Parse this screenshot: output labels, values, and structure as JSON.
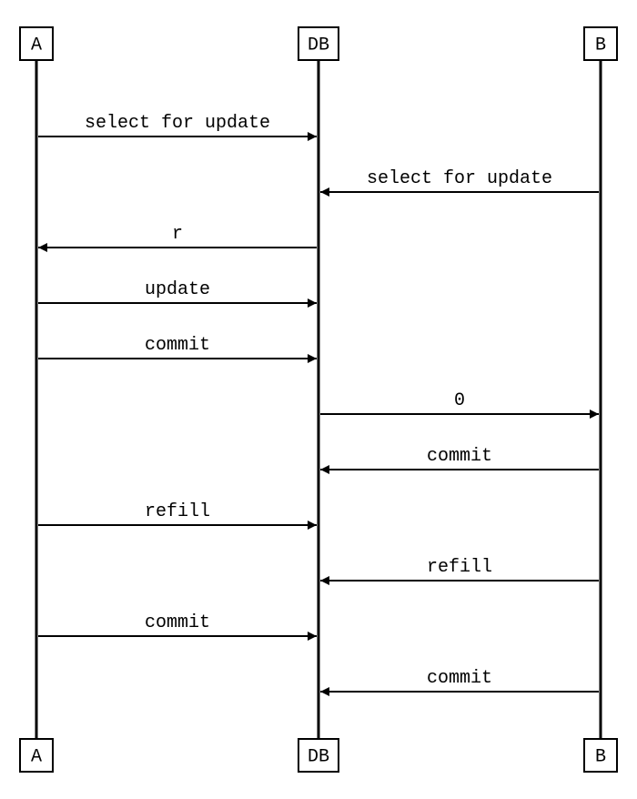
{
  "chart_data": {
    "type": "sequence",
    "actors": [
      {
        "id": "A",
        "label": "A"
      },
      {
        "id": "DB",
        "label": "DB"
      },
      {
        "id": "B",
        "label": "B"
      }
    ],
    "messages": [
      {
        "from": "A",
        "to": "DB",
        "label": "select for update"
      },
      {
        "from": "B",
        "to": "DB",
        "label": "select for update"
      },
      {
        "from": "DB",
        "to": "A",
        "label": "r"
      },
      {
        "from": "A",
        "to": "DB",
        "label": "update"
      },
      {
        "from": "A",
        "to": "DB",
        "label": "commit"
      },
      {
        "from": "DB",
        "to": "B",
        "label": "0"
      },
      {
        "from": "B",
        "to": "DB",
        "label": "commit"
      },
      {
        "from": "A",
        "to": "DB",
        "label": "refill"
      },
      {
        "from": "B",
        "to": "DB",
        "label": "refill"
      },
      {
        "from": "A",
        "to": "DB",
        "label": "commit"
      },
      {
        "from": "B",
        "to": "DB",
        "label": "commit"
      }
    ]
  }
}
